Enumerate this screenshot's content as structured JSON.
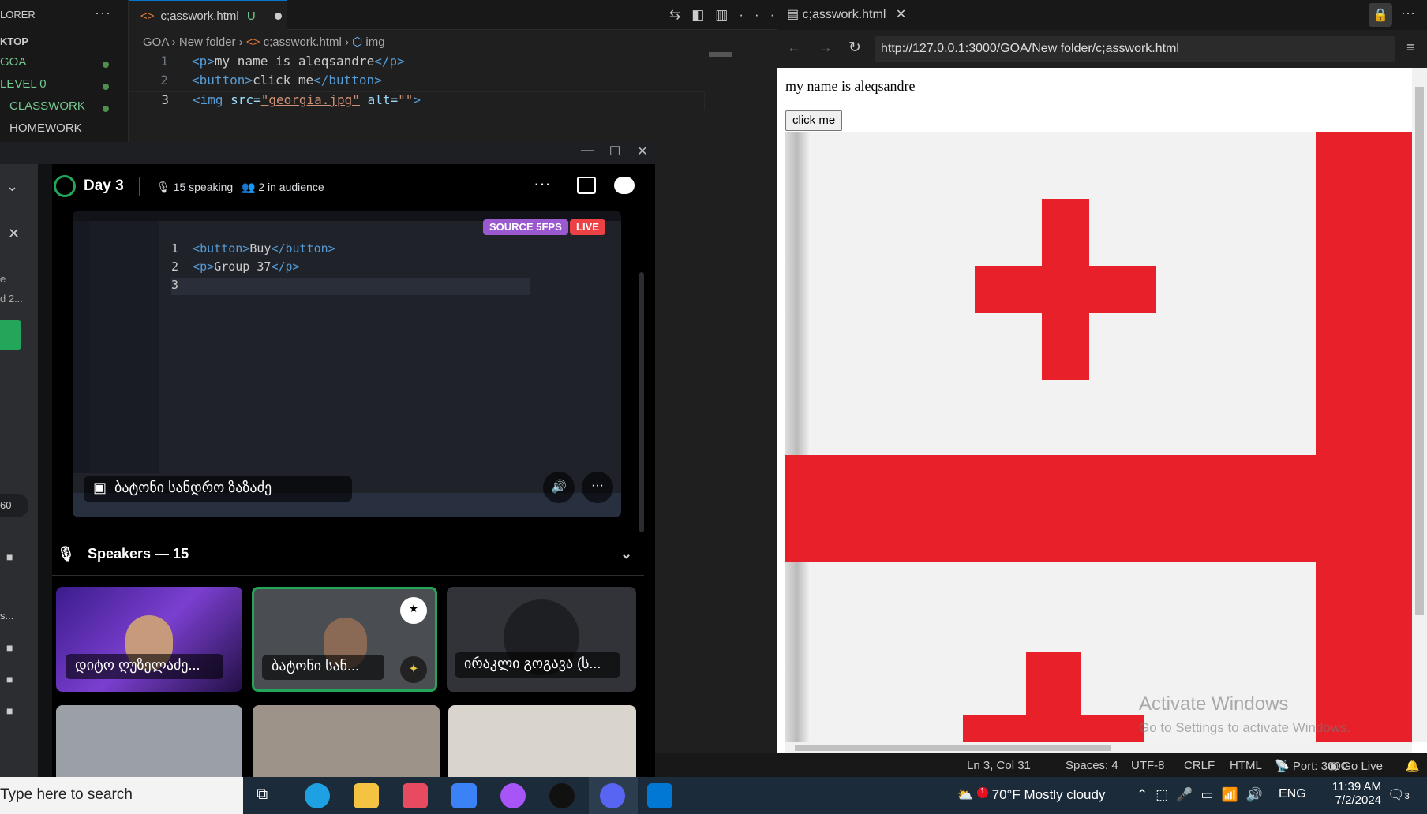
{
  "vscode": {
    "explorer_title": "LORER",
    "tree": [
      {
        "label": "KTOP",
        "bold": true
      },
      {
        "label": "GOA",
        "color": "#73c991"
      },
      {
        "label": "LEVEL 0",
        "color": "#73c991"
      },
      {
        "label": "CLASSWORK",
        "color": "#73c991"
      },
      {
        "label": "HOMEWORK",
        "color": "#cccccc"
      }
    ],
    "active_tab": "c;asswork.html",
    "active_tab_status": "U",
    "breadcrumb": [
      "GOA",
      "New folder",
      "c;asswork.html",
      "img"
    ],
    "code": {
      "line1": {
        "num": "1",
        "open": "<p>",
        "text": "my name is aleqsandre",
        "close": "</p>"
      },
      "line2": {
        "num": "2",
        "open": "<button>",
        "text": "click me",
        "close": "</button>"
      },
      "line3": {
        "num": "3",
        "tag": "<img",
        "src_attr": "src=",
        "src_val": "\"georgia.jpg\"",
        "alt_attr": "alt=",
        "alt_val": "\"\"",
        "end": ">"
      }
    }
  },
  "discord": {
    "stage_title": "Day 3",
    "speaking": "15 speaking",
    "audience": "2 in audience",
    "share": {
      "badge_source": "SOURCE 5FPS",
      "badge_live": "LIVE",
      "code1_open": "<button>",
      "code1_text": "Buy",
      "code1_close": "</button>",
      "code2_open": "<p>",
      "code2_text": "Group 37",
      "code2_close": "</p>",
      "streamer_name": "ბატონი სანდრო ზაზაძე"
    },
    "speakers_header": "Speakers — 15",
    "tiles": [
      {
        "name": "დიტო ღუზელაძე..."
      },
      {
        "name": "ბატონი სან..."
      },
      {
        "name": "ირაკლი გოგავა (ს..."
      }
    ],
    "left_snippets": {
      "a": "e",
      "b": "d 2...",
      "c": "60",
      "d": "s..."
    }
  },
  "browser": {
    "tab_title": "c;asswork.html",
    "url": "http://127.0.0.1:3000/GOA/New folder/c;asswork.html",
    "page_text": "my name is aleqsandre",
    "page_button": "click me",
    "watermark_title": "Activate Windows",
    "watermark_sub": "Go to Settings to activate Windows."
  },
  "statusbar": {
    "position": "Ln 3, Col 31",
    "spaces": "Spaces: 4",
    "encoding": "UTF-8",
    "eol": "CRLF",
    "language": "HTML",
    "port": "Port: 3000",
    "golive": "Go Live"
  },
  "taskbar": {
    "search_placeholder": "Type here to search",
    "weather": "70°F  Mostly cloudy",
    "weather_badge": "1",
    "lang": "ENG",
    "time": "11:39 AM",
    "date": "7/2/2024",
    "notif_count": "3"
  },
  "colors": {
    "accent": "#0078d4",
    "discord_green": "#23a55a",
    "live_red": "#ed4245",
    "source_purple": "#9b59d0",
    "flag_red": "#e8202a"
  }
}
